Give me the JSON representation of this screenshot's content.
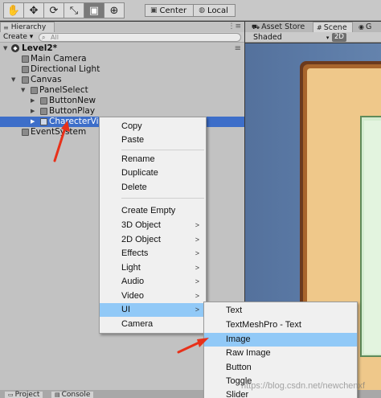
{
  "toolbar": {
    "tools": [
      {
        "icon": "hand-icon",
        "glyph": "✋"
      },
      {
        "icon": "move-icon",
        "glyph": "✥"
      },
      {
        "icon": "rotate-icon",
        "glyph": "⟳"
      },
      {
        "icon": "scale-icon",
        "glyph": "⤡"
      },
      {
        "icon": "rect-icon",
        "glyph": "▣"
      },
      {
        "icon": "transform-icon",
        "glyph": "⊕"
      }
    ],
    "active_tool_index": 4,
    "pivot_label": "Center",
    "space_label": "Local"
  },
  "hierarchy": {
    "tab_label": "Hierarchy",
    "create_label": "Create ▾",
    "search_placeholder": "All",
    "scene_name": "Level2*",
    "items": [
      {
        "label": "Main Camera"
      },
      {
        "label": "Directional Light"
      },
      {
        "label": "Canvas"
      },
      {
        "label": "PanelSelect"
      },
      {
        "label": "ButtonNew"
      },
      {
        "label": "ButtonPlay"
      },
      {
        "label": "CharecterVie"
      },
      {
        "label": "EventSystem"
      }
    ]
  },
  "scene": {
    "tabs": [
      {
        "label": "Asset Store"
      },
      {
        "label": "Scene"
      },
      {
        "label": "G"
      }
    ],
    "shading_mode": "Shaded",
    "mode_2d": "2D"
  },
  "context_menu": {
    "items": [
      {
        "label": "Copy"
      },
      {
        "label": "Paste"
      },
      {
        "label": "Rename"
      },
      {
        "label": "Duplicate"
      },
      {
        "label": "Delete"
      },
      {
        "label": "Create Empty"
      },
      {
        "label": "3D Object",
        "submenu": true
      },
      {
        "label": "2D Object",
        "submenu": true
      },
      {
        "label": "Effects",
        "submenu": true
      },
      {
        "label": "Light",
        "submenu": true
      },
      {
        "label": "Audio",
        "submenu": true
      },
      {
        "label": "Video",
        "submenu": true
      },
      {
        "label": "UI",
        "submenu": true
      },
      {
        "label": "Camera"
      }
    ],
    "highlighted": "UI"
  },
  "ui_submenu": {
    "items": [
      {
        "label": "Text"
      },
      {
        "label": "TextMeshPro - Text"
      },
      {
        "label": "Image"
      },
      {
        "label": "Raw Image"
      },
      {
        "label": "Button"
      },
      {
        "label": "Toggle"
      },
      {
        "label": "Slider"
      }
    ],
    "highlighted": "Image"
  },
  "bottom_tabs": [
    {
      "label": "Project"
    },
    {
      "label": "Console"
    }
  ],
  "watermark": "https://blog.csdn.net/newchenxf",
  "colors": {
    "selection": "#3d6ec9",
    "menu_highlight": "#91c9f7",
    "annotation": "#e8311a"
  }
}
